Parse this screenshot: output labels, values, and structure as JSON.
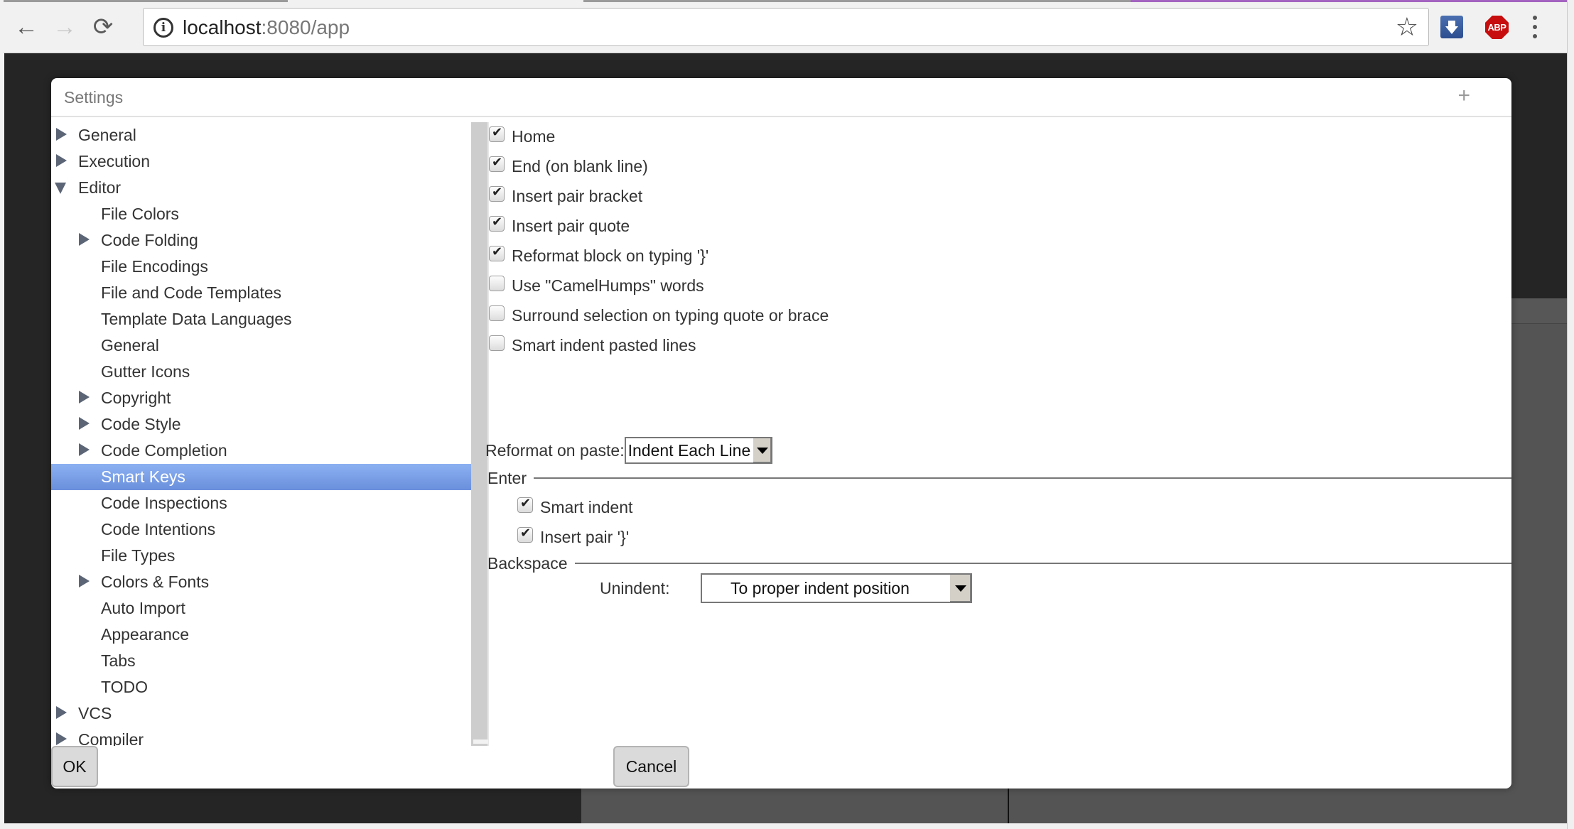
{
  "browser": {
    "back_label": "←",
    "forward_label": "→",
    "reload_label": "⟳",
    "url_host": "localhost",
    "url_rest": ":8080/app",
    "info_icon": "i",
    "star_icon": "☆",
    "abp_label": "ABP"
  },
  "dialog": {
    "title": "Settings",
    "plus_label": "+",
    "tree": [
      {
        "label": "General",
        "level": 0,
        "toggle": "closed"
      },
      {
        "label": "Execution",
        "level": 0,
        "toggle": "closed"
      },
      {
        "label": "Editor",
        "level": 0,
        "toggle": "open"
      },
      {
        "label": "File Colors",
        "level": 1,
        "toggle": "none"
      },
      {
        "label": "Code Folding",
        "level": 1,
        "toggle": "closed"
      },
      {
        "label": "File Encodings",
        "level": 1,
        "toggle": "none"
      },
      {
        "label": "File and Code Templates",
        "level": 1,
        "toggle": "none"
      },
      {
        "label": "Template Data Languages",
        "level": 1,
        "toggle": "none"
      },
      {
        "label": "General",
        "level": 1,
        "toggle": "none"
      },
      {
        "label": "Gutter Icons",
        "level": 1,
        "toggle": "none"
      },
      {
        "label": "Copyright",
        "level": 1,
        "toggle": "closed"
      },
      {
        "label": "Code Style",
        "level": 1,
        "toggle": "closed"
      },
      {
        "label": "Code Completion",
        "level": 1,
        "toggle": "closed"
      },
      {
        "label": "Smart Keys",
        "level": 1,
        "toggle": "none",
        "selected": true
      },
      {
        "label": "Code Inspections",
        "level": 1,
        "toggle": "none"
      },
      {
        "label": "Code Intentions",
        "level": 1,
        "toggle": "none"
      },
      {
        "label": "File Types",
        "level": 1,
        "toggle": "none"
      },
      {
        "label": "Colors & Fonts",
        "level": 1,
        "toggle": "closed"
      },
      {
        "label": "Auto Import",
        "level": 1,
        "toggle": "none"
      },
      {
        "label": "Appearance",
        "level": 1,
        "toggle": "none"
      },
      {
        "label": "Tabs",
        "level": 1,
        "toggle": "none"
      },
      {
        "label": "TODO",
        "level": 1,
        "toggle": "none"
      },
      {
        "label": "VCS",
        "level": 0,
        "toggle": "closed"
      },
      {
        "label": "Compiler",
        "level": 0,
        "toggle": "closed"
      }
    ],
    "options": [
      {
        "label": "Home",
        "checked": true
      },
      {
        "label": "End (on blank line)",
        "checked": true
      },
      {
        "label": "Insert pair bracket",
        "checked": true
      },
      {
        "label": "Insert pair quote",
        "checked": true
      },
      {
        "label": "Reformat block on typing '}'",
        "checked": true
      },
      {
        "label": "Use \"CamelHumps\" words",
        "checked": false
      },
      {
        "label": "Surround selection on typing quote or brace",
        "checked": false
      },
      {
        "label": "Smart indent pasted lines",
        "checked": false
      }
    ],
    "reformat_on_paste": {
      "label": "Reformat on paste:",
      "value": "Indent Each Line"
    },
    "enter_group": {
      "legend": "Enter",
      "options": [
        {
          "label": "Smart indent",
          "checked": true
        },
        {
          "label": "Insert pair '}'",
          "checked": true
        }
      ]
    },
    "backspace_group": {
      "legend": "Backspace",
      "unindent_label": "Unindent:",
      "unindent_value": "To proper indent position"
    },
    "ok_label": "OK",
    "cancel_label": "Cancel"
  },
  "colors": {
    "selection_top": "#8cb1f2",
    "selection_bottom": "#6a8fdc",
    "abp_red": "#c70d0d",
    "active_tab_accent": "#a463c0"
  }
}
